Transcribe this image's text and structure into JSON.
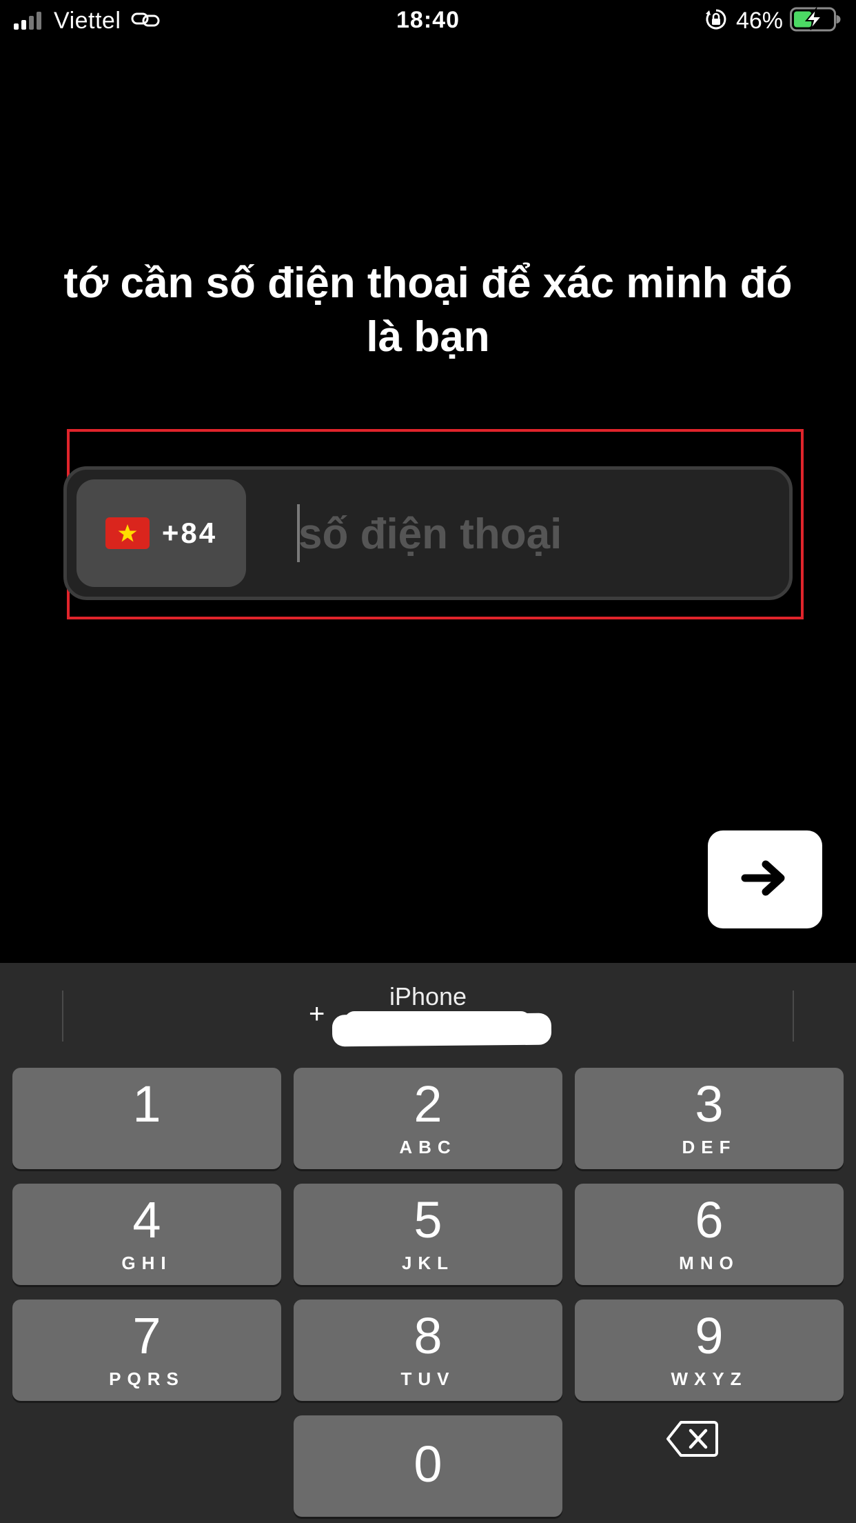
{
  "status_bar": {
    "carrier": "Viettel",
    "time": "18:40",
    "battery_percent": "46%",
    "battery_level": 0.46,
    "charging": true,
    "icons": [
      "signal-icon",
      "link-icon",
      "orientation-lock-icon",
      "battery-icon"
    ]
  },
  "heading": "tớ cần số điện thoại để xác minh đó là bạn",
  "phone_field": {
    "country_flag": "vietnam-flag-icon",
    "dial_code": "+84",
    "placeholder": "số điện thoại",
    "value": ""
  },
  "next_button": {
    "icon": "arrow-right-icon"
  },
  "keyboard": {
    "suggestion": {
      "name": "iPhone",
      "number_prefix": "+"
    },
    "keys": [
      {
        "num": "1",
        "letters": ""
      },
      {
        "num": "2",
        "letters": "ABC"
      },
      {
        "num": "3",
        "letters": "DEF"
      },
      {
        "num": "4",
        "letters": "GHI"
      },
      {
        "num": "5",
        "letters": "JKL"
      },
      {
        "num": "6",
        "letters": "MNO"
      },
      {
        "num": "7",
        "letters": "PQRS"
      },
      {
        "num": "8",
        "letters": "TUV"
      },
      {
        "num": "9",
        "letters": "WXYZ"
      },
      {
        "num": "0",
        "letters": ""
      }
    ],
    "backspace_icon": "backspace-icon"
  },
  "colors": {
    "background": "#000000",
    "highlight_border": "#e0242b",
    "key": "#6b6b6b",
    "keyboard_bg": "#2b2b2b",
    "battery_fill": "#4cd964"
  }
}
